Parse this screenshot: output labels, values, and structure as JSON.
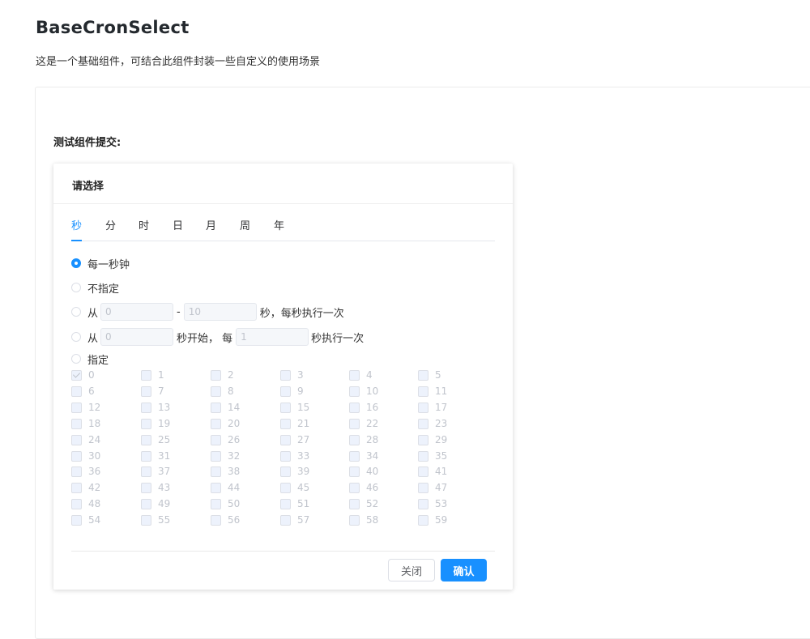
{
  "page": {
    "title": "BaseCronSelect",
    "description": "这是一个基础组件，可结合此组件封装一些自定义的使用场景",
    "form_label": "测试组件提交:"
  },
  "dialog": {
    "title": "请选择",
    "tabs": [
      "秒",
      "分",
      "时",
      "日",
      "月",
      "周",
      "年"
    ],
    "active_tab": "秒",
    "options": {
      "every": "每一秒钟",
      "none": "不指定",
      "range_prefix": "从",
      "range_from": "0",
      "range_dash": "-",
      "range_to": "10",
      "range_suffix": "秒，每秒执行一次",
      "interval_prefix": "从",
      "interval_start": "0",
      "interval_mid": "秒开始， 每",
      "interval_step": "1",
      "interval_suffix": "秒执行一次",
      "specific": "指定"
    },
    "selected_option": "every",
    "seconds": [
      "0",
      "1",
      "2",
      "3",
      "4",
      "5",
      "6",
      "7",
      "8",
      "9",
      "10",
      "11",
      "12",
      "13",
      "14",
      "15",
      "16",
      "17",
      "18",
      "19",
      "20",
      "21",
      "22",
      "23",
      "24",
      "25",
      "26",
      "27",
      "28",
      "29",
      "30",
      "31",
      "32",
      "33",
      "34",
      "35",
      "36",
      "37",
      "38",
      "39",
      "40",
      "41",
      "42",
      "43",
      "44",
      "45",
      "46",
      "47",
      "48",
      "49",
      "50",
      "51",
      "52",
      "53",
      "54",
      "55",
      "56",
      "57",
      "58",
      "59"
    ],
    "checked_seconds": [
      "0"
    ],
    "buttons": {
      "close": "关闭",
      "confirm": "确认"
    }
  },
  "colors": {
    "accent": "#1890ff",
    "disabled_text": "#c0c4cc",
    "border": "#dcdfe6"
  }
}
